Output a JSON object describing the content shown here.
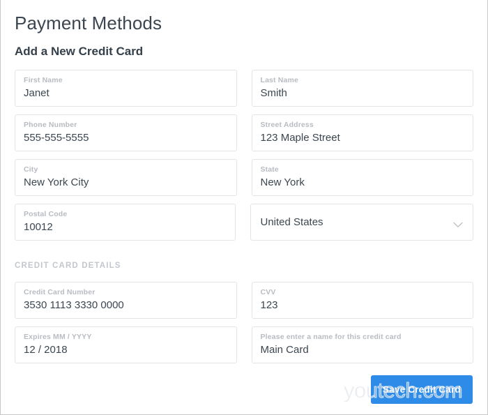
{
  "page": {
    "title": "Payment Methods",
    "section_title": "Add a New Credit Card",
    "group_heading": "CREDIT CARD DETAILS",
    "watermark": "youtech.com",
    "accent_color": "#2e8ce8",
    "text_color": "#3c4650",
    "label_color": "#b8bcc2",
    "border_color": "#e2e4e6"
  },
  "form": {
    "rows": [
      [
        {
          "name": "first-name",
          "label": "First Name",
          "value": "Janet",
          "type": "text"
        },
        {
          "name": "last-name",
          "label": "Last Name",
          "value": "Smith",
          "type": "text"
        }
      ],
      [
        {
          "name": "phone-number",
          "label": "Phone Number",
          "value": "555-555-5555",
          "type": "text"
        },
        {
          "name": "street-address",
          "label": "Street Address",
          "value": "123 Maple Street",
          "type": "text"
        }
      ],
      [
        {
          "name": "city",
          "label": "City",
          "value": "New York City",
          "type": "text"
        },
        {
          "name": "state",
          "label": "State",
          "value": "New York",
          "type": "text"
        }
      ],
      [
        {
          "name": "postal-code",
          "label": "Postal Code",
          "value": "10012",
          "type": "text"
        },
        {
          "name": "country",
          "label": "",
          "value": "United States",
          "type": "select",
          "icon": "chevron-down-icon"
        }
      ]
    ],
    "card_rows": [
      [
        {
          "name": "credit-card-number",
          "label": "Credit Card Number",
          "value": "3530 1113 3330 0000",
          "type": "text"
        },
        {
          "name": "cvv",
          "label": "CVV",
          "value": "123",
          "type": "text"
        }
      ],
      [
        {
          "name": "expires",
          "label": "Expires MM / YYYY",
          "value": "12 / 2018",
          "type": "text"
        },
        {
          "name": "card-nickname",
          "label": "Please enter a name for this credit card",
          "value": "Main Card",
          "type": "text"
        }
      ]
    ]
  },
  "actions": {
    "save_label": "Save Credit Card"
  }
}
